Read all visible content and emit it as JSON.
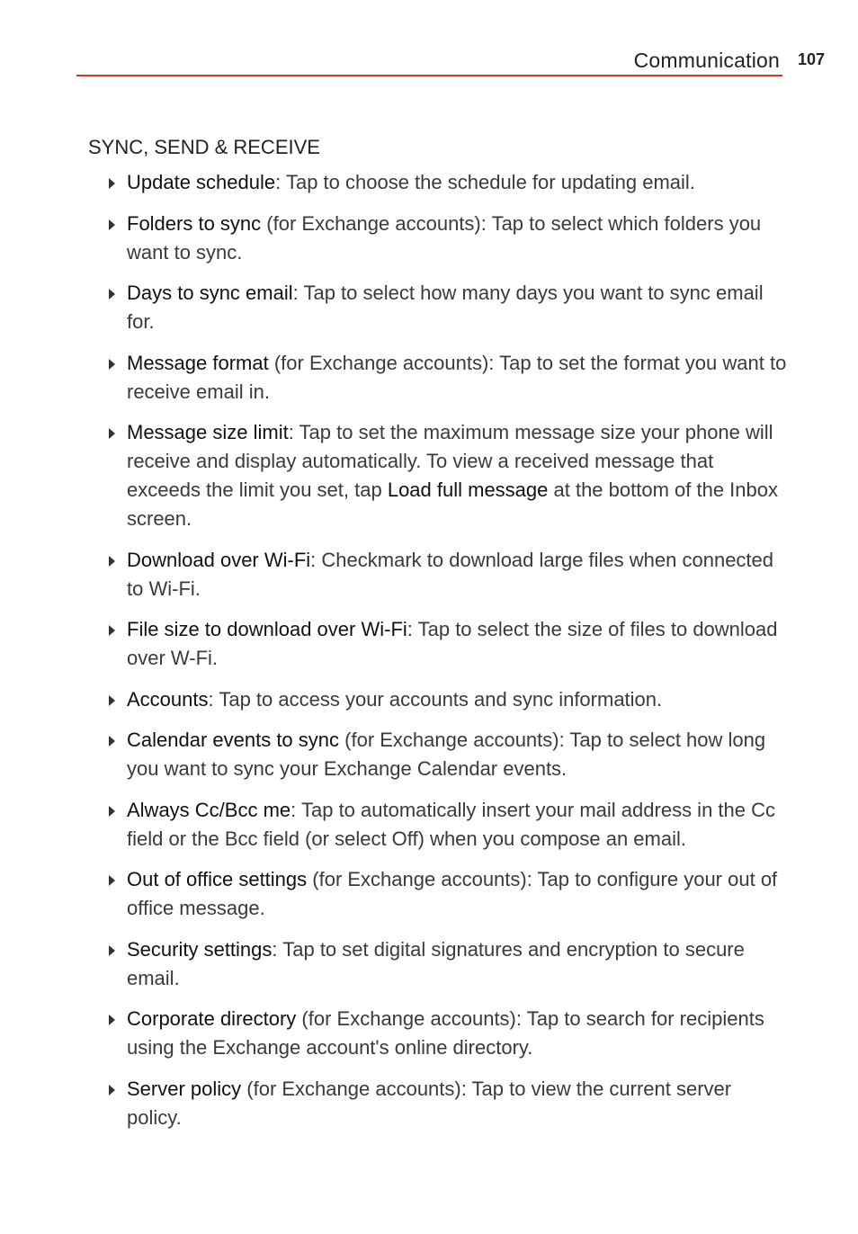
{
  "header": {
    "title": "Communication",
    "page_number": "107"
  },
  "section": {
    "title": "SYNC, SEND & RECEIVE"
  },
  "items": [
    {
      "segments": [
        {
          "t": "Update schedule",
          "b": true
        },
        {
          "t": ": Tap to choose the schedule for updating email."
        }
      ]
    },
    {
      "segments": [
        {
          "t": "Folders to sync",
          "b": true
        },
        {
          "t": " (for Exchange accounts): Tap to select which folders you want to sync."
        }
      ]
    },
    {
      "segments": [
        {
          "t": "Days to sync email",
          "b": true
        },
        {
          "t": ": Tap to select how many days you want to sync email for."
        }
      ]
    },
    {
      "segments": [
        {
          "t": "Message format",
          "b": true
        },
        {
          "t": " (for Exchange accounts): Tap to set the format you want to receive email in."
        }
      ]
    },
    {
      "segments": [
        {
          "t": "Message size limit",
          "b": true
        },
        {
          "t": ": Tap to set the maximum message size your phone will receive and display automatically. To view a received message that exceeds the limit you set, tap "
        },
        {
          "t": "Load full message",
          "b": true
        },
        {
          "t": " at the bottom of the Inbox screen."
        }
      ]
    },
    {
      "segments": [
        {
          "t": "Download over Wi-Fi",
          "b": true
        },
        {
          "t": ": Checkmark to download large files when connected to Wi-Fi."
        }
      ]
    },
    {
      "segments": [
        {
          "t": "File size to download over Wi-Fi",
          "b": true
        },
        {
          "t": ": Tap to select the size of files to download over W-Fi."
        }
      ]
    },
    {
      "segments": [
        {
          "t": "Accounts",
          "b": true
        },
        {
          "t": ": Tap to access your accounts and sync information."
        }
      ]
    },
    {
      "segments": [
        {
          "t": "Calendar events to sync",
          "b": true
        },
        {
          "t": " (for Exchange accounts): Tap to select how long you want to sync your Exchange Calendar events."
        }
      ]
    },
    {
      "segments": [
        {
          "t": "Always Cc/Bcc me",
          "b": true
        },
        {
          "t": ": Tap to automatically insert your mail address in the Cc field or the Bcc field (or select Off) when you compose an email."
        }
      ]
    },
    {
      "segments": [
        {
          "t": "Out of office settings",
          "b": true
        },
        {
          "t": " (for Exchange accounts): Tap to configure your out of office message."
        }
      ]
    },
    {
      "segments": [
        {
          "t": "Security settings",
          "b": true
        },
        {
          "t": ": Tap to set digital signatures and encryption to secure email."
        }
      ]
    },
    {
      "segments": [
        {
          "t": "Corporate directory",
          "b": true
        },
        {
          "t": " (for Exchange accounts): Tap to search for recipients using the Exchange account's online directory."
        }
      ]
    },
    {
      "segments": [
        {
          "t": "Server policy",
          "b": true
        },
        {
          "t": " (for Exchange accounts): Tap to view the current server policy."
        }
      ]
    }
  ],
  "colors": {
    "accent_rule": "#d8322c",
    "text": "#3a3a3a",
    "term": "#111111"
  }
}
